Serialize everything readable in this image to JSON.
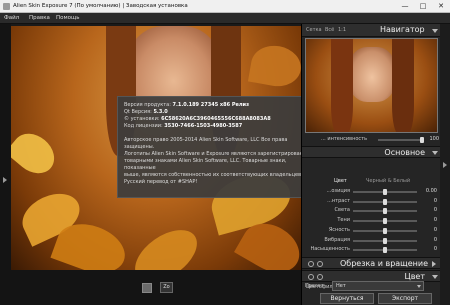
{
  "window": {
    "title": "Alien Skin Exposure 7 (По умолчанию) | Заводская установка",
    "minimize": "—",
    "maximize": "□",
    "close": "✕"
  },
  "menu": [
    "Файл",
    "Правка",
    "Помощь"
  ],
  "about": {
    "version_label": "Версия продукта:",
    "version_value": "7.1.0.189 27345 x86 Релиз",
    "qt_label": "Qt Версия:",
    "qt_value": "5.3.0",
    "installed_label": "© установки:",
    "installed_value": "6C58620A6C3960465556C688A8083A8",
    "license_label": "Код лицензии:",
    "license_value": "3530-7466-1503-4980-3587",
    "copyright_lines": [
      "Авторское право 2005-2014 Alien Skin Software, LLC Все права защищены.",
      "Логотипы Alien Skin Software и Exposure являются зарегистрированными",
      "товарными знаками Alien Skin Software, LLC. Товарные знаки, показанные",
      "выше, являются собственностью их соответствующих владельцев.",
      "Русский перевод от #SHAP!"
    ]
  },
  "bottombar": {
    "zoom_label": "Zo"
  },
  "navigator": {
    "tab_fit": "Сетка",
    "tab_all": "Всё",
    "tab_ratio": "1:1",
    "title": "Навигатор"
  },
  "intensity": {
    "label": "... интенсивность",
    "value": "100"
  },
  "basic": {
    "title": "Основное",
    "tab_color": "Цвет",
    "tab_bw": "Черный & Белый",
    "sliders": [
      {
        "label": "...озиция",
        "value": "0.00",
        "level": 0.5
      },
      {
        "label": "...нтраст",
        "value": "0",
        "level": 0.5
      },
      {
        "label": "Света",
        "value": "0",
        "level": 0.5
      },
      {
        "label": "Тени",
        "value": "0",
        "level": 0.5
      },
      {
        "label": "Ясность",
        "value": "0",
        "level": 0.5
      },
      {
        "label": "Вибрация",
        "value": "0",
        "level": 0.5
      },
      {
        "label": "Насыщенность",
        "value": "0",
        "level": 0.5
      }
    ]
  },
  "crop": {
    "title": "Обрезка и вращение"
  },
  "color": {
    "title": "Цвет"
  },
  "color_filter": {
    "label": "Цветофильтр",
    "preset_label": "Пресет",
    "preset_value": "Нет"
  },
  "actions": {
    "return": "Вернуться",
    "export": "Экспорт"
  }
}
